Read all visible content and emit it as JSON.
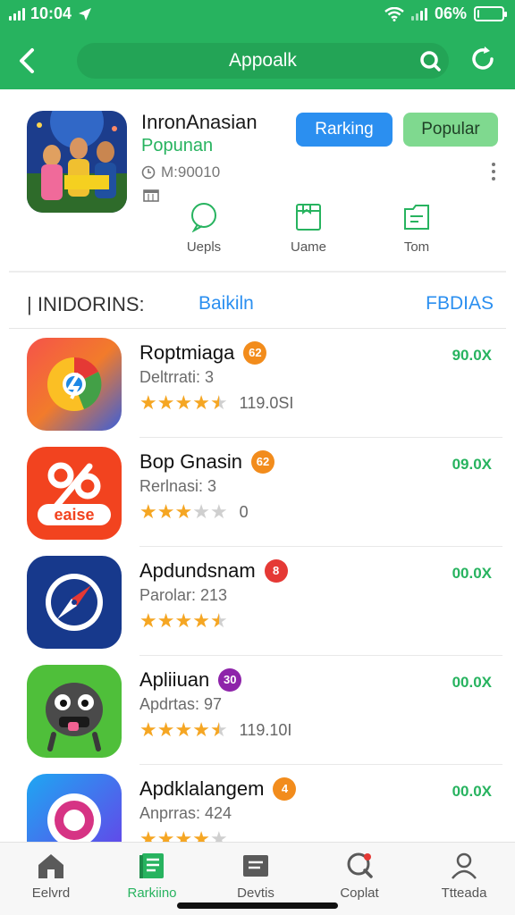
{
  "status_bar": {
    "time": "10:04",
    "battery": "06%",
    "battery_level": 0.06
  },
  "header": {
    "title": "Appoalk",
    "colors": {
      "bar": "#27b35f",
      "search_pill": "#23a456"
    }
  },
  "featured": {
    "name": "InronAnasian",
    "subtitle": "Popunan",
    "time": "M:90010",
    "btn_ranking": "Rarking",
    "btn_popular": "Popular",
    "actions": [
      {
        "label": "Uepls",
        "icon": "chat-bubble-icon"
      },
      {
        "label": "Uame",
        "icon": "bookmark-folder-icon"
      },
      {
        "label": "Tom",
        "icon": "archive-icon"
      }
    ]
  },
  "section": {
    "title": "| INIDORINS:",
    "tab": "Baikiln",
    "more": "FBDIAS"
  },
  "apps": [
    {
      "name": "Roptmiaga",
      "badge": "62",
      "badge_color": "#f28c1c",
      "sub": "Deltrrati: 3",
      "rating": 4.5,
      "count": "119.0SI",
      "price": "90.0X",
      "icon": "chrome-like-icon"
    },
    {
      "name": "Bop Gnasin",
      "badge": "62",
      "badge_color": "#f28c1c",
      "sub": "Rerlnasi: 3",
      "rating": 3,
      "count": "0",
      "price": "09.0X",
      "icon": "scissors-sale-icon"
    },
    {
      "name": "Apdundsnam",
      "badge": "8",
      "badge_color": "#e53935",
      "sub": "Parolar: 213",
      "rating": 4.5,
      "count": "",
      "price": "00.0X",
      "icon": "compass-icon"
    },
    {
      "name": "Apliiuan",
      "badge": "30",
      "badge_color": "#8e24aa",
      "sub": "Apdrtas: 97",
      "rating": 4.5,
      "count": "119.10I",
      "price": "00.0X",
      "icon": "monster-game-icon"
    },
    {
      "name": "Apdklalangem",
      "badge": "4",
      "badge_color": "#f28c1c",
      "sub": "Anprras: 424",
      "rating": 4,
      "count": "",
      "price": "00.0X",
      "icon": "camera-lens-icon"
    }
  ],
  "nav": [
    {
      "label": "Eelvrd",
      "icon": "home-icon"
    },
    {
      "label": "Rarkiino",
      "icon": "ranking-book-icon",
      "active": true
    },
    {
      "label": "Devtis",
      "icon": "folder-icon"
    },
    {
      "label": "Coplat",
      "icon": "chat-search-icon"
    },
    {
      "label": "Ttteada",
      "icon": "profile-icon"
    }
  ]
}
